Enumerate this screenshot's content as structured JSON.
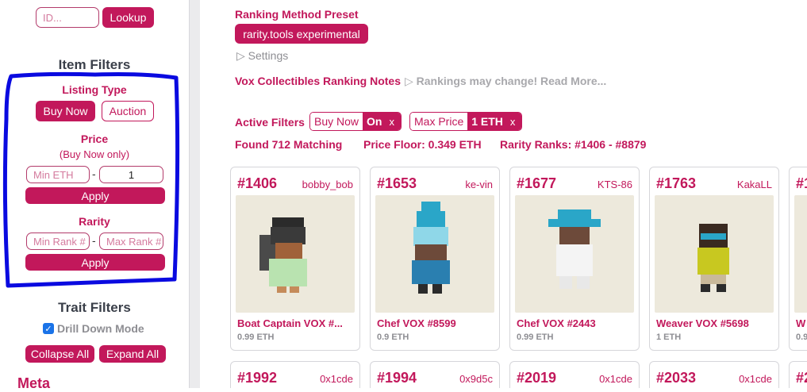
{
  "sidebar": {
    "id_placeholder": "ID...",
    "lookup_label": "Lookup",
    "item_filters_title": "Item Filters",
    "listing_type_title": "Listing Type",
    "buy_now_label": "Buy Now",
    "auction_label": "Auction",
    "price_title": "Price",
    "price_note": "(Buy Now only)",
    "min_eth_placeholder": "Min ETH",
    "dash": "-",
    "max_eth_value": "1",
    "apply_label": "Apply",
    "rarity_title": "Rarity",
    "min_rank_placeholder": "Min Rank #",
    "max_rank_placeholder": "Max Rank #",
    "trait_filters_title": "Trait Filters",
    "drill_down_label": "Drill Down Mode",
    "collapse_all_label": "Collapse All",
    "expand_all_label": "Expand All",
    "meta_label": "Meta"
  },
  "main": {
    "preset_title": "Ranking Method Preset",
    "preset_value": "rarity.tools experimental",
    "settings_label": "▷ Settings",
    "notes_title": "Vox Collectibles Ranking Notes",
    "notes_link": "▷ Rankings may change! Read More...",
    "active_filters_label": "Active Filters",
    "filter1_key": "Buy Now",
    "filter1_value": "On",
    "filter2_key": "Max Price",
    "filter2_value": "1 ETH",
    "filter_close": "x",
    "found_text": "Found 712 Matching",
    "price_floor_text": "Price Floor: 0.349 ETH",
    "rarity_ranks_text": "Rarity Ranks: #1406 - #8879"
  },
  "cards": [
    {
      "rank": "#1406",
      "owner": "bobby_bob",
      "name": "Boat Captain VOX #...",
      "price": "0.99 ETH"
    },
    {
      "rank": "#1653",
      "owner": "ke-vin",
      "name": "Chef VOX #8599",
      "price": "0.9 ETH"
    },
    {
      "rank": "#1677",
      "owner": "KTS-86",
      "name": "Chef VOX #2443",
      "price": "0.99 ETH"
    },
    {
      "rank": "#1763",
      "owner": "KakaLL",
      "name": "Weaver VOX #5698",
      "price": "1 ETH"
    },
    {
      "rank": "#1",
      "owner": "",
      "name": "W",
      "price": "0.9"
    }
  ],
  "cards_row2": [
    {
      "rank": "#1992",
      "owner": "0x1cde"
    },
    {
      "rank": "#1994",
      "owner": "0x9d5c"
    },
    {
      "rank": "#2019",
      "owner": "0x1cde"
    },
    {
      "rank": "#2033",
      "owner": "0x1cde"
    },
    {
      "rank": "#2",
      "owner": ""
    }
  ],
  "colors": {
    "accent": "#c2185b",
    "annotation": "#0a0ae0",
    "card_bg": "#ede9dc"
  }
}
